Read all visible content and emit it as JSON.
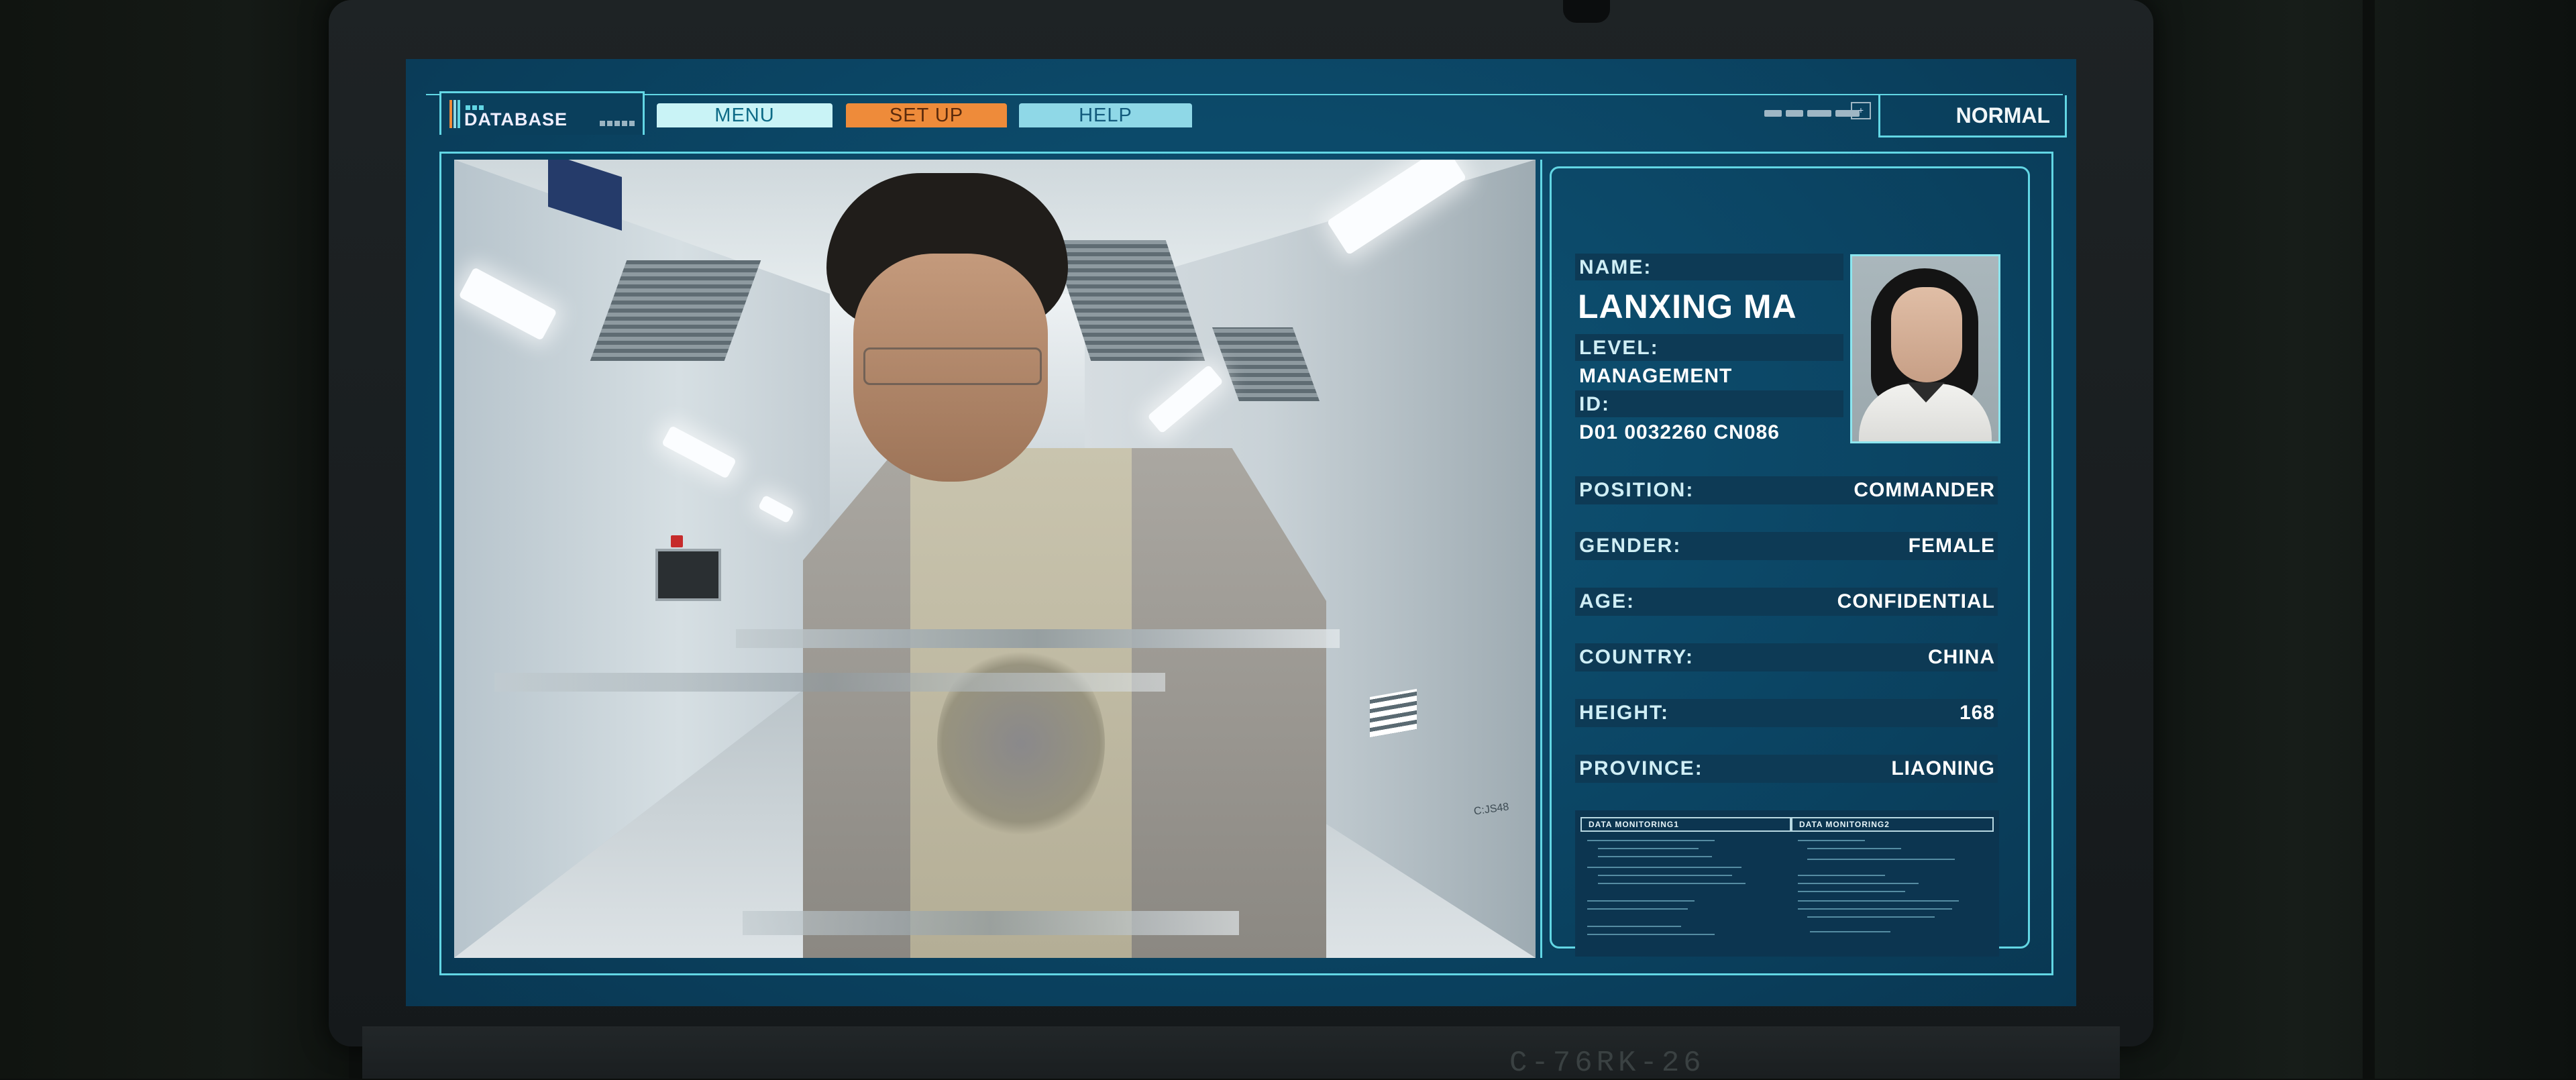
{
  "header": {
    "database_label": "DATABASE",
    "tabs": [
      {
        "id": "menu",
        "label": "MENU"
      },
      {
        "id": "setup",
        "label": "SET UP"
      },
      {
        "id": "help",
        "label": "HELP"
      }
    ],
    "mode_label": "NORMAL"
  },
  "profile": {
    "name_label": "NAME:",
    "name": "LANXING MA",
    "level_label": "LEVEL:",
    "level": "MANAGEMENT",
    "id_label": "ID:",
    "id": "D01 0032260 CN086",
    "fields": [
      {
        "label": "POSITION:",
        "value": "COMMANDER"
      },
      {
        "label": "GENDER:",
        "value": "FEMALE"
      },
      {
        "label": "AGE:",
        "value": "CONFIDENTIAL"
      },
      {
        "label": "COUNTRY:",
        "value": "CHINA"
      },
      {
        "label": "HEIGHT:",
        "value": "168"
      },
      {
        "label": "PROVINCE:",
        "value": "LIAONING"
      }
    ]
  },
  "monitoring": {
    "panel1_title": "DATA MONITORING1",
    "panel2_title": "DATA MONITORING2"
  },
  "feed": {
    "door_code": "C:JS48"
  },
  "monitor_stand_label": "C-76RK-26",
  "colors": {
    "accent": "#62d6e4",
    "screen_bg": "#0b4564",
    "tab_menu": "#c9f3f6",
    "tab_setup": "#ee8b3a",
    "tab_help": "#8fd8e7"
  }
}
